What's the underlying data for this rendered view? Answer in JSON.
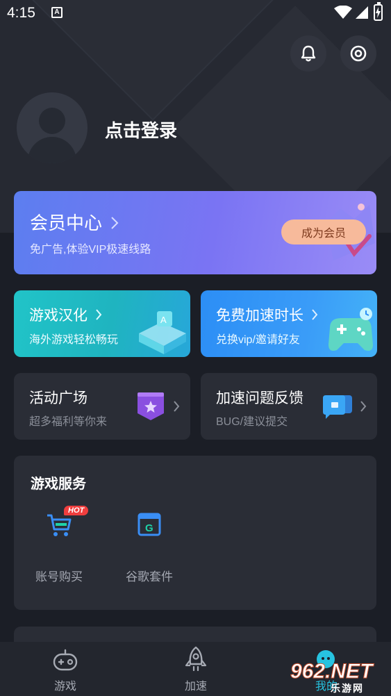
{
  "status_bar": {
    "time": "4:15",
    "app_icon_letter": "A"
  },
  "header": {
    "login_text": "点击登录"
  },
  "vip": {
    "title": "会员中心",
    "subtitle": "免广告,体验VIP极速线路",
    "button": "成为会员"
  },
  "cards": {
    "localize": {
      "title": "游戏汉化",
      "subtitle": "海外游戏轻松畅玩"
    },
    "free_time": {
      "title": "免费加速时长",
      "subtitle": "兑换vip/邀请好友"
    },
    "activity": {
      "title": "活动广场",
      "subtitle": "超多福利等你来"
    },
    "feedback": {
      "title": "加速问题反馈",
      "subtitle": "BUG/建议提交"
    }
  },
  "services": {
    "title": "游戏服务",
    "items": [
      {
        "label": "账号购买",
        "badge": "HOT",
        "icon": "cart-icon"
      },
      {
        "label": "谷歌套件",
        "icon": "google-suite-icon",
        "icon_letter": "G"
      }
    ]
  },
  "bottom_nav": {
    "items": [
      {
        "label": "游戏",
        "icon": "gamepad-icon"
      },
      {
        "label": "加速",
        "icon": "rocket-icon"
      },
      {
        "label": "我的",
        "icon": "profile-icon"
      }
    ]
  },
  "watermark": {
    "brand": "962.NET",
    "sub": "乐游网"
  },
  "colors": {
    "background": "#1b1e26",
    "card": "#2a2d36",
    "vip_gradient_start": "#5c7ef0",
    "vip_gradient_end": "#9a8cf6",
    "vip_button": "#f7ba9b",
    "localize_card": "#21c4c8",
    "free_time_card": "#2c8ef5",
    "hot_badge": "#f03e3e"
  }
}
